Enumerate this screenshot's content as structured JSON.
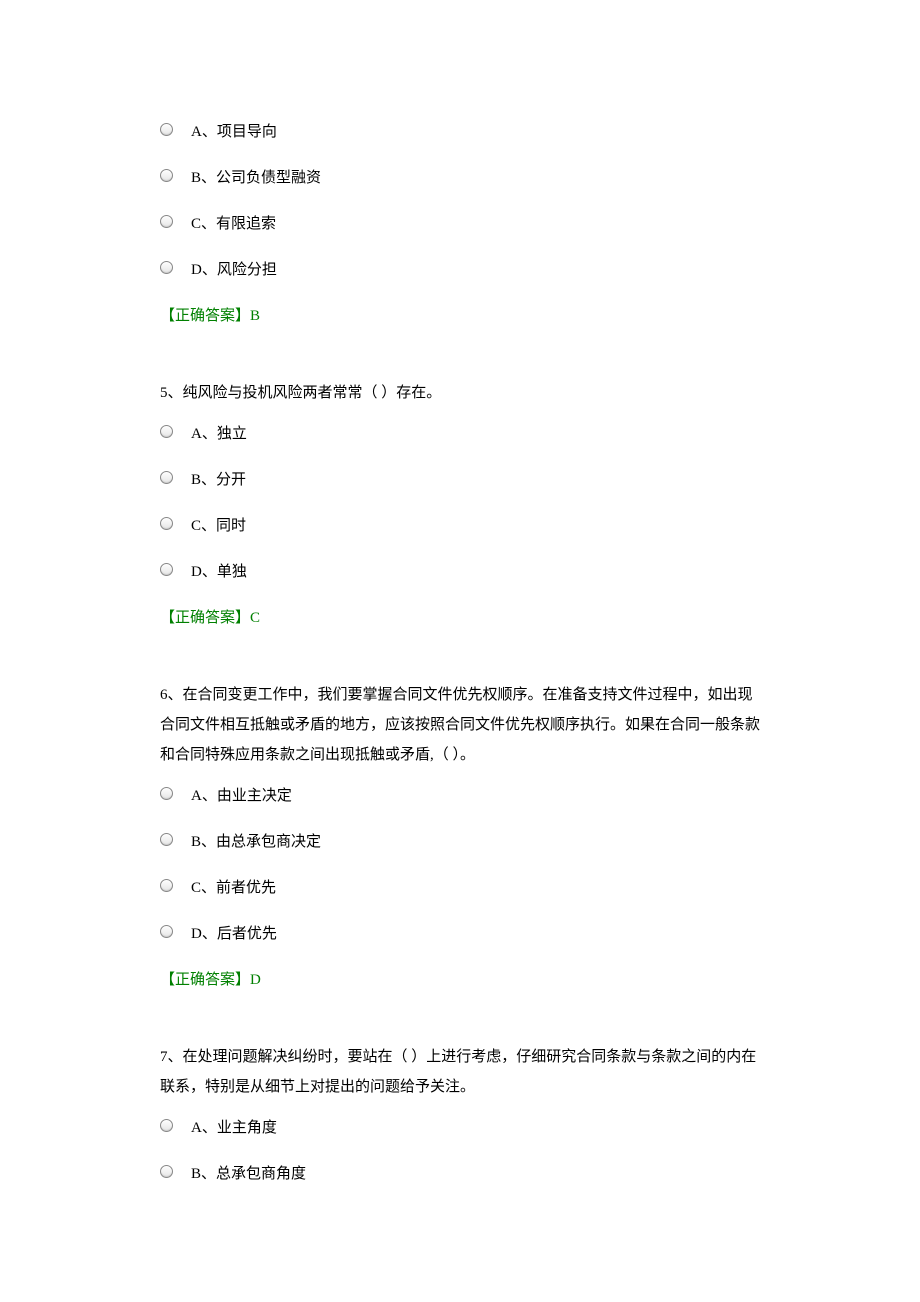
{
  "questions": [
    {
      "stem": "",
      "options": [
        "A、项目导向",
        "B、公司负债型融资",
        "C、有限追索",
        "D、风险分担"
      ],
      "answer_label": "【正确答案】",
      "answer_value": "B"
    },
    {
      "stem": "5、纯风险与投机风险两者常常（  ）存在。",
      "options": [
        "A、独立",
        "B、分开",
        "C、同时",
        "D、单独"
      ],
      "answer_label": "【正确答案】",
      "answer_value": "C"
    },
    {
      "stem": "6、在合同变更工作中，我们要掌握合同文件优先权顺序。在准备支持文件过程中，如出现合同文件相互抵触或矛盾的地方，应该按照合同文件优先权顺序执行。如果在合同一般条款和合同特殊应用条款之间出现抵触或矛盾,（  ）。",
      "options": [
        "A、由业主决定",
        "B、由总承包商决定",
        "C、前者优先",
        "D、后者优先"
      ],
      "answer_label": "【正确答案】",
      "answer_value": "D"
    },
    {
      "stem": "7、在处理问题解决纠纷时，要站在（ ）上进行考虑，仔细研究合同条款与条款之间的内在联系，特别是从细节上对提出的问题给予关注。",
      "options": [
        "A、业主角度",
        "B、总承包商角度"
      ],
      "answer_label": "",
      "answer_value": ""
    }
  ]
}
